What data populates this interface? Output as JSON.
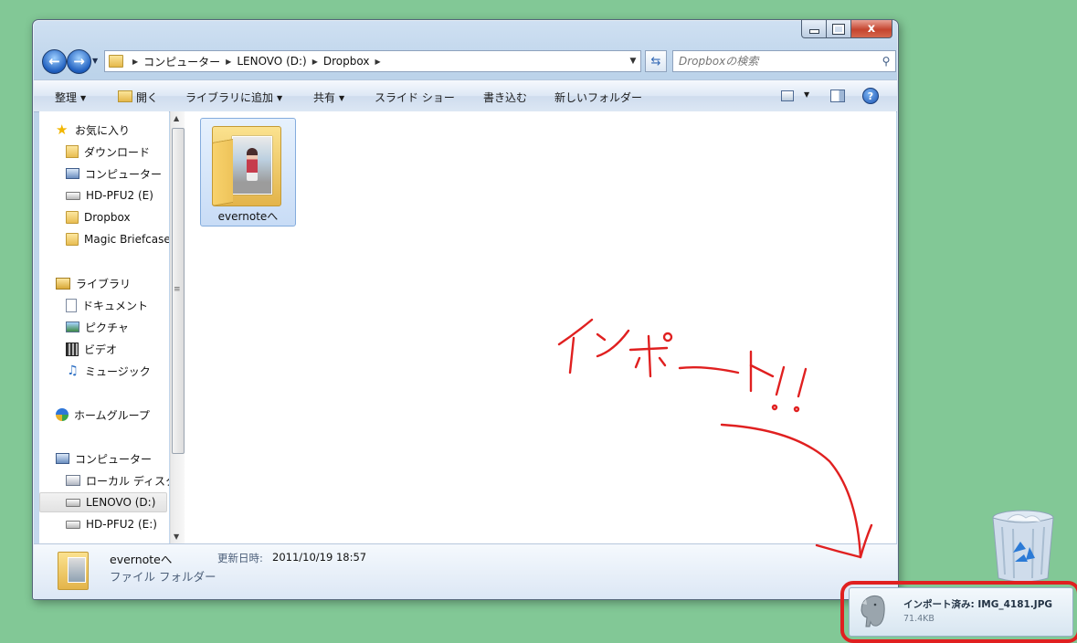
{
  "window": {
    "caption": {
      "minimize": "",
      "maximize": "",
      "close": "x"
    },
    "address_crumbs": [
      "コンピューター",
      "LENOVO (D:)",
      "Dropbox"
    ],
    "search_placeholder": "Dropboxの検索"
  },
  "toolbar": {
    "organize": "整理",
    "open": "開く",
    "add_to_library": "ライブラリに追加",
    "share": "共有",
    "slideshow": "スライド ショー",
    "burn": "書き込む",
    "new_folder": "新しいフォルダー"
  },
  "nav_pane": {
    "favorites": {
      "header": "お気に入り",
      "items": [
        "ダウンロード",
        "コンピューター",
        "HD-PFU2 (E)",
        "Dropbox",
        "Magic Briefcase"
      ]
    },
    "libraries": {
      "header": "ライブラリ",
      "items": [
        "ドキュメント",
        "ピクチャ",
        "ビデオ",
        "ミュージック"
      ]
    },
    "homegroup": "ホームグループ",
    "computer": {
      "header": "コンピューター",
      "items": [
        "ローカル ディスク",
        "LENOVO (D:)",
        "HD-PFU2 (E:)"
      ],
      "selected": "LENOVO (D:)"
    }
  },
  "content": {
    "items": [
      {
        "name": "evernoteへ"
      }
    ]
  },
  "details": {
    "name": "evernoteへ",
    "type": "ファイル フォルダー",
    "date_label": "更新日時:",
    "date_value": "2011/10/19 18:57"
  },
  "annotation": {
    "handwritten_text": "インポート!!",
    "color": "#e02020"
  },
  "notification": {
    "title": "インポート済み: IMG_4181.JPG",
    "size": "71.4KB",
    "icon": "evernote-elephant-icon"
  },
  "colors": {
    "desktop": "#82c896",
    "selection": "#c8dcf6",
    "annotation_red": "#e02020"
  }
}
